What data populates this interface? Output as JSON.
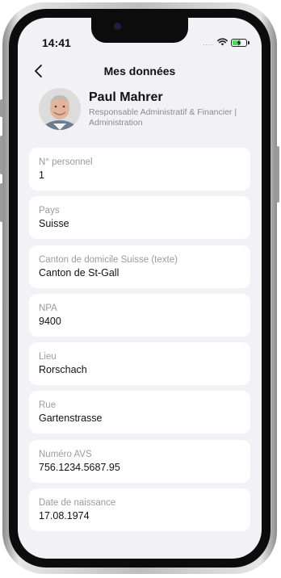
{
  "status_bar": {
    "time": "14:41",
    "signal_dots": "....",
    "wifi_icon": "wifi-icon",
    "battery_icon": "battery-charging-icon",
    "battery_color": "#4cd964"
  },
  "nav": {
    "title": "Mes données",
    "back_icon": "chevron-left-icon"
  },
  "profile": {
    "name": "Paul Mahrer",
    "role": "Responsable Administratif & Financier | Administration"
  },
  "fields": [
    {
      "label": "N° personnel",
      "value": "1"
    },
    {
      "label": "Pays",
      "value": "Suisse"
    },
    {
      "label": "Canton de domicile Suisse (texte)",
      "value": "Canton de St-Gall"
    },
    {
      "label": "NPA",
      "value": "9400"
    },
    {
      "label": "Lieu",
      "value": "Rorschach"
    },
    {
      "label": "Rue",
      "value": "Gartenstrasse"
    },
    {
      "label": "Numéro AVS",
      "value": "756.1234.5687.95"
    },
    {
      "label": "Date de naissance",
      "value": "17.08.1974"
    }
  ],
  "colors": {
    "screen_background": "#f1f1f6",
    "card_background": "#ffffff",
    "label_gray": "#9a9aa0",
    "text_dark": "#111111"
  }
}
